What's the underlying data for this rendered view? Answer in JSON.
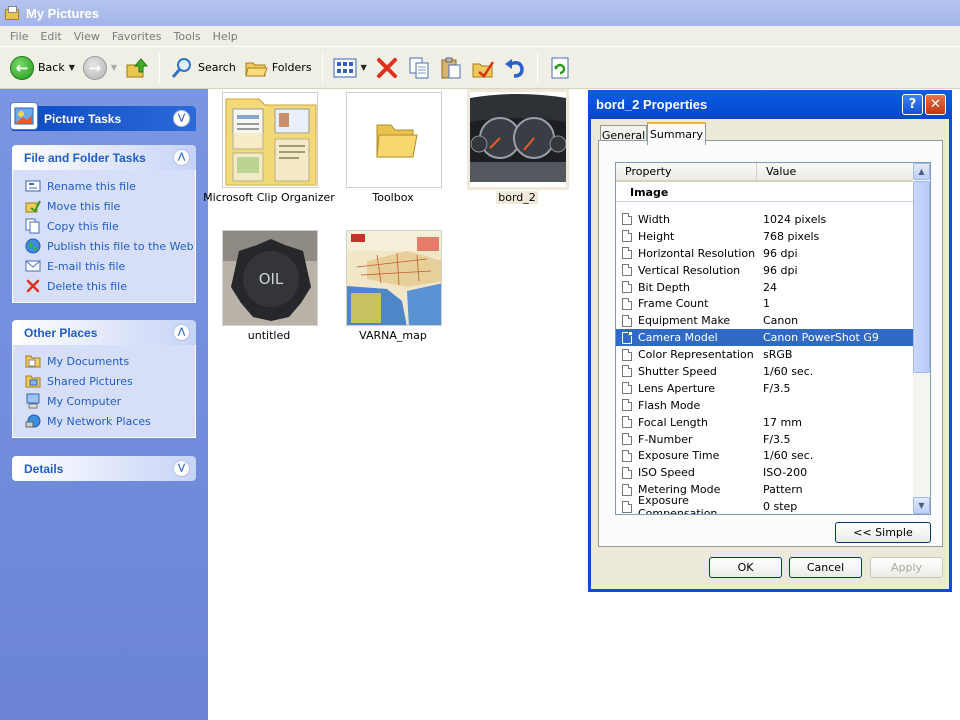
{
  "window": {
    "title": "My Pictures"
  },
  "menu": [
    "File",
    "Edit",
    "View",
    "Favorites",
    "Tools",
    "Help"
  ],
  "toolbar": {
    "back_label": "Back",
    "search_label": "Search",
    "folders_label": "Folders"
  },
  "sidebar": {
    "picture_tasks_title": "Picture Tasks",
    "file_tasks_title": "File and Folder Tasks",
    "file_tasks": [
      {
        "label": "Rename this file",
        "icon": "rename-icon"
      },
      {
        "label": "Move this file",
        "icon": "move-icon"
      },
      {
        "label": "Copy this file",
        "icon": "copy-icon"
      },
      {
        "label": "Publish this file to the Web",
        "icon": "globe-icon"
      },
      {
        "label": "E-mail this file",
        "icon": "email-icon"
      },
      {
        "label": "Delete this file",
        "icon": "delete-icon"
      }
    ],
    "other_places_title": "Other Places",
    "other_places": [
      {
        "label": "My Documents",
        "icon": "folder-icon"
      },
      {
        "label": "Shared Pictures",
        "icon": "folder-icon"
      },
      {
        "label": "My Computer",
        "icon": "computer-icon"
      },
      {
        "label": "My Network Places",
        "icon": "network-icon"
      }
    ],
    "details_title": "Details"
  },
  "files": [
    {
      "name": "Microsoft Clip Organizer"
    },
    {
      "name": "Toolbox"
    },
    {
      "name": "bord_2"
    },
    {
      "name": "untitled"
    },
    {
      "name": "VARNA_map"
    }
  ],
  "dialog": {
    "title": "bord_2 Properties",
    "tab_general": "General",
    "tab_summary": "Summary",
    "col_property": "Property",
    "col_value": "Value",
    "group": "Image",
    "selected_index": 7,
    "rows": [
      {
        "k": "Width",
        "v": "1024 pixels"
      },
      {
        "k": "Height",
        "v": "768 pixels"
      },
      {
        "k": "Horizontal Resolution",
        "v": "96 dpi"
      },
      {
        "k": "Vertical Resolution",
        "v": "96 dpi"
      },
      {
        "k": "Bit Depth",
        "v": "24"
      },
      {
        "k": "Frame Count",
        "v": "1"
      },
      {
        "k": "Equipment Make",
        "v": "Canon"
      },
      {
        "k": "Camera Model",
        "v": "Canon PowerShot G9"
      },
      {
        "k": "Color Representation",
        "v": "sRGB"
      },
      {
        "k": "Shutter Speed",
        "v": "1/60 sec."
      },
      {
        "k": "Lens Aperture",
        "v": "F/3.5"
      },
      {
        "k": "Flash Mode",
        "v": ""
      },
      {
        "k": "Focal Length",
        "v": "17 mm"
      },
      {
        "k": "F-Number",
        "v": "F/3.5"
      },
      {
        "k": "Exposure Time",
        "v": "1/60 sec."
      },
      {
        "k": "ISO Speed",
        "v": "ISO-200"
      },
      {
        "k": "Metering Mode",
        "v": "Pattern"
      },
      {
        "k": "Exposure Compensation",
        "v": "0 step"
      }
    ],
    "simple_button": "<< Simple",
    "ok": "OK",
    "cancel": "Cancel",
    "apply": "Apply"
  }
}
